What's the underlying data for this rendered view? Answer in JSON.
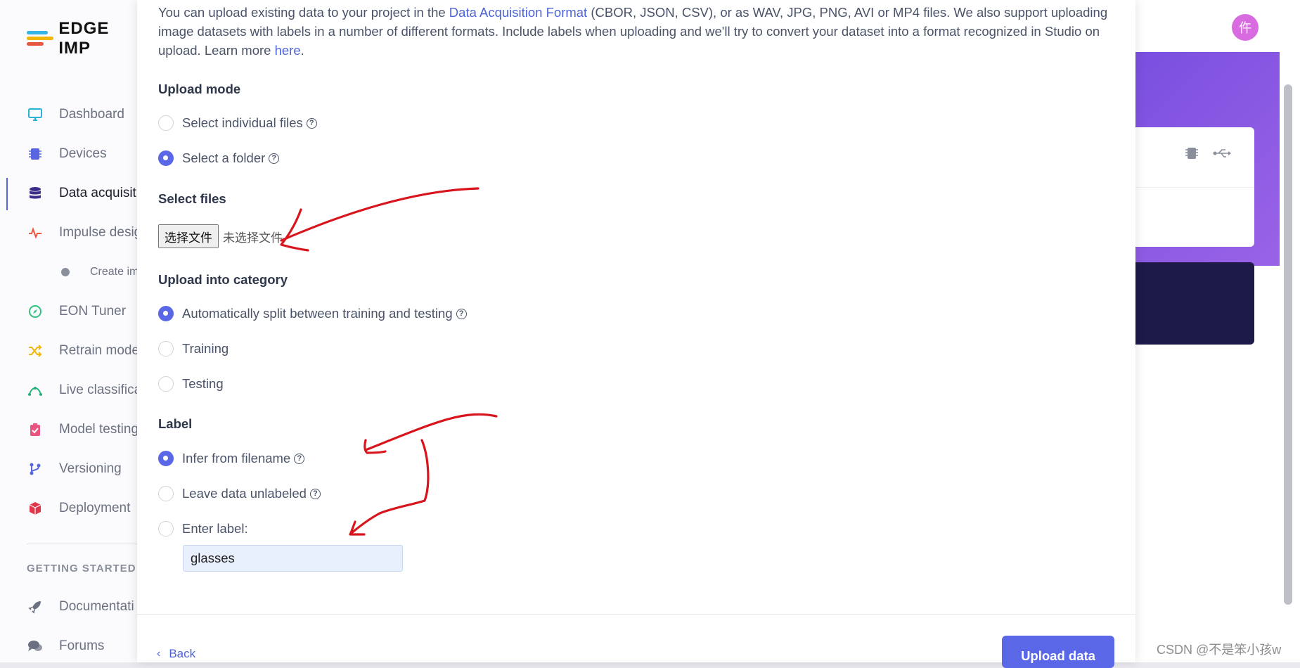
{
  "app": {
    "logo_text": "EDGE IMP",
    "avatar_char": "仵",
    "watermark": "CSDN @不是笨小孩w"
  },
  "sidebar": {
    "items": [
      {
        "label": "Dashboard",
        "icon": "monitor-icon",
        "color": "#2bb0d6"
      },
      {
        "label": "Devices",
        "icon": "chip-icon",
        "color": "#5a66e0"
      },
      {
        "label": "Data acquisiti",
        "icon": "database-icon",
        "color": "#3b2c8a",
        "active": true
      },
      {
        "label": "Impulse desig",
        "icon": "pulse-icon",
        "color": "#e8553f"
      },
      {
        "label": "Create im",
        "icon": "dot-icon",
        "color": "#8a8f9c",
        "sub": true
      },
      {
        "label": "EON Tuner",
        "icon": "compass-icon",
        "color": "#2ec27e"
      },
      {
        "label": "Retrain mode",
        "icon": "shuffle-icon",
        "color": "#f2b705"
      },
      {
        "label": "Live classifica",
        "icon": "curve-icon",
        "color": "#28b07a"
      },
      {
        "label": "Model testing",
        "icon": "clipboard-icon",
        "color": "#e8557f"
      },
      {
        "label": "Versioning",
        "icon": "branch-icon",
        "color": "#5a66e0"
      },
      {
        "label": "Deployment",
        "icon": "box-icon",
        "color": "#e0364a"
      }
    ],
    "section_title": "GETTING STARTED",
    "extra_items": [
      {
        "label": "Documentati",
        "icon": "rocket-icon",
        "color": "#6b7180"
      },
      {
        "label": "Forums",
        "icon": "chat-icon",
        "color": "#6b7180"
      }
    ]
  },
  "modal": {
    "intro_pre": "You can upload existing data to your project in the ",
    "intro_link": "Data Acquisition Format",
    "intro_mid": " (CBOR, JSON, CSV), or as WAV, JPG, PNG, AVI or MP4 files. We also support uploading image datasets with labels in a number of different formats. Include labels when uploading and we'll try to convert your dataset into a format recognized in Studio on upload. Learn more ",
    "intro_link2": "here",
    "intro_end": ".",
    "upload_mode": {
      "title": "Upload mode",
      "options": [
        "Select individual files",
        "Select a folder"
      ],
      "selected": 1
    },
    "select_files": {
      "title": "Select files",
      "button": "选择文件",
      "status": "未选择文件"
    },
    "category": {
      "title": "Upload into category",
      "options": [
        "Automatically split between training and testing",
        "Training",
        "Testing"
      ],
      "selected": 0
    },
    "label": {
      "title": "Label",
      "options": [
        "Infer from filename",
        "Leave data unlabeled",
        "Enter label:"
      ],
      "selected": 0,
      "value": "glasses"
    },
    "back": "Back",
    "upload": "Upload data"
  },
  "colors": {
    "accent": "#5a68e8",
    "link": "#4d63d9",
    "annotation": "#d8141c"
  }
}
